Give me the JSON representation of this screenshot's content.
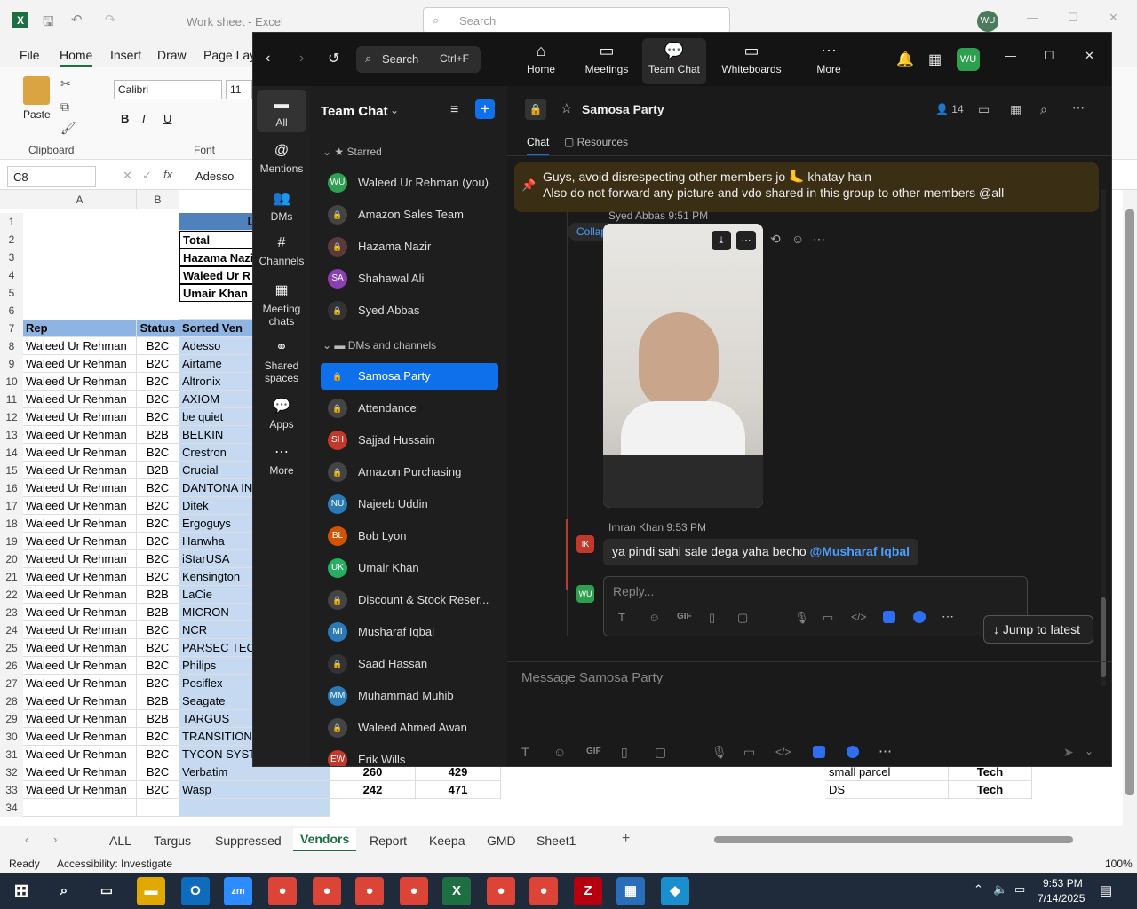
{
  "excel": {
    "title": "Work sheet  -  Excel",
    "search_placeholder": "Search",
    "user_initials": "WU",
    "menu": [
      "File",
      "Home",
      "Insert",
      "Draw",
      "Page Layo"
    ],
    "ribbon": {
      "paste": "Paste",
      "clipboard": "Clipboard",
      "font_name": "Calibri",
      "font_size": "11",
      "font_group": "Font"
    },
    "name_box": "C8",
    "formula": "Adesso",
    "columns": [
      "A",
      "B"
    ],
    "top_rows": [
      {
        "n": "1",
        "c": "Lis"
      },
      {
        "n": "2",
        "c": "Total"
      },
      {
        "n": "3",
        "c": "Hazama Nazi"
      },
      {
        "n": "4",
        "c": "Waleed Ur R"
      },
      {
        "n": "5",
        "c": "Umair Khan"
      },
      {
        "n": "6",
        "c": ""
      }
    ],
    "header_row": {
      "n": "7",
      "a": "Rep",
      "b": "Status",
      "c": "Sorted Ven"
    },
    "rows": [
      {
        "n": "8",
        "a": "Waleed Ur Rehman",
        "b": "B2C",
        "c": "Adesso"
      },
      {
        "n": "9",
        "a": "Waleed Ur Rehman",
        "b": "B2C",
        "c": "Airtame"
      },
      {
        "n": "10",
        "a": "Waleed Ur Rehman",
        "b": "B2C",
        "c": "Altronix"
      },
      {
        "n": "11",
        "a": "Waleed Ur Rehman",
        "b": "B2C",
        "c": "AXIOM"
      },
      {
        "n": "12",
        "a": "Waleed Ur Rehman",
        "b": "B2C",
        "c": "be quiet"
      },
      {
        "n": "13",
        "a": "Waleed Ur Rehman",
        "b": "B2B",
        "c": "BELKIN"
      },
      {
        "n": "14",
        "a": "Waleed Ur Rehman",
        "b": "B2C",
        "c": "Crestron"
      },
      {
        "n": "15",
        "a": "Waleed Ur Rehman",
        "b": "B2B",
        "c": "Crucial"
      },
      {
        "n": "16",
        "a": "Waleed Ur Rehman",
        "b": "B2C",
        "c": "DANTONA IN"
      },
      {
        "n": "17",
        "a": "Waleed Ur Rehman",
        "b": "B2C",
        "c": "Ditek"
      },
      {
        "n": "18",
        "a": "Waleed Ur Rehman",
        "b": "B2C",
        "c": "Ergoguys"
      },
      {
        "n": "19",
        "a": "Waleed Ur Rehman",
        "b": "B2C",
        "c": "Hanwha"
      },
      {
        "n": "20",
        "a": "Waleed Ur Rehman",
        "b": "B2C",
        "c": "iStarUSA"
      },
      {
        "n": "21",
        "a": "Waleed Ur Rehman",
        "b": "B2C",
        "c": "Kensington"
      },
      {
        "n": "22",
        "a": "Waleed Ur Rehman",
        "b": "B2B",
        "c": "LaCie"
      },
      {
        "n": "23",
        "a": "Waleed Ur Rehman",
        "b": "B2B",
        "c": "MICRON"
      },
      {
        "n": "24",
        "a": "Waleed Ur Rehman",
        "b": "B2C",
        "c": "NCR"
      },
      {
        "n": "25",
        "a": "Waleed Ur Rehman",
        "b": "B2C",
        "c": "PARSEC TECH"
      },
      {
        "n": "26",
        "a": "Waleed Ur Rehman",
        "b": "B2C",
        "c": "Philips"
      },
      {
        "n": "27",
        "a": "Waleed Ur Rehman",
        "b": "B2C",
        "c": "Posiflex"
      },
      {
        "n": "28",
        "a": "Waleed Ur Rehman",
        "b": "B2B",
        "c": "Seagate"
      },
      {
        "n": "29",
        "a": "Waleed Ur Rehman",
        "b": "B2B",
        "c": "TARGUS"
      },
      {
        "n": "30",
        "a": "Waleed Ur Rehman",
        "b": "B2C",
        "c": "TRANSITION"
      },
      {
        "n": "31",
        "a": "Waleed Ur Rehman",
        "b": "B2C",
        "c": "TYCON SYSTE"
      },
      {
        "n": "32",
        "a": "Waleed Ur Rehman",
        "b": "B2C",
        "c": "Verbatim",
        "d": "260",
        "e": "429",
        "j": "small parcel",
        "k": "Tech"
      },
      {
        "n": "33",
        "a": "Waleed Ur Rehman",
        "b": "B2C",
        "c": "Wasp",
        "d": "242",
        "e": "471",
        "j": "DS",
        "k": "Tech"
      },
      {
        "n": "34",
        "a": "",
        "b": "",
        "c": ""
      }
    ],
    "sheet_tabs": [
      "ALL",
      "Targus",
      "Suppressed",
      "Vendors",
      "Report",
      "Keepa",
      "GMD",
      "Sheet1"
    ],
    "active_sheet": "Vendors",
    "status_ready": "Ready",
    "accessibility": "Accessibility: Investigate",
    "zoom": "100%"
  },
  "zoom": {
    "search_label": "Search",
    "search_shortcut": "Ctrl+F",
    "nav": [
      "Home",
      "Meetings",
      "Team Chat",
      "Whiteboards",
      "More"
    ],
    "user_initials": "WU",
    "rail": [
      "All",
      "Mentions",
      "DMs",
      "Channels",
      "Meeting chats",
      "Shared spaces",
      "Apps",
      "More"
    ],
    "list_title": "Team Chat",
    "starred_header": "Starred",
    "starred": [
      {
        "name": "Waleed Ur Rehman (you)",
        "initials": "WU",
        "color": "#2e9e4f"
      },
      {
        "name": "Amazon Sales Team",
        "initials": "",
        "color": "#444"
      },
      {
        "name": "Hazama Nazir",
        "initials": "",
        "color": "#5a3a3a"
      },
      {
        "name": "Shahawal Ali",
        "initials": "SA",
        "color": "#8a3fb3"
      },
      {
        "name": "Syed Abbas",
        "initials": "",
        "color": "#333"
      }
    ],
    "dm_header": "DMs and channels",
    "dms": [
      {
        "name": "Samosa Party",
        "initials": "",
        "color": "#0e71eb"
      },
      {
        "name": "Attendance",
        "initials": "",
        "color": "#444"
      },
      {
        "name": "Sajjad Hussain",
        "initials": "SH",
        "color": "#c0392b"
      },
      {
        "name": "Amazon Purchasing",
        "initials": "",
        "color": "#444"
      },
      {
        "name": "Najeeb Uddin",
        "initials": "NU",
        "color": "#2a7ab8"
      },
      {
        "name": "Bob Lyon",
        "initials": "BL",
        "color": "#d35400"
      },
      {
        "name": "Umair Khan",
        "initials": "UK",
        "color": "#27ae60"
      },
      {
        "name": "Discount & Stock Reser...",
        "initials": "",
        "color": "#444"
      },
      {
        "name": "Musharaf Iqbal",
        "initials": "MI",
        "color": "#2a7ab8"
      },
      {
        "name": "Saad Hassan",
        "initials": "",
        "color": "#333"
      },
      {
        "name": "Muhammad Muhib",
        "initials": "MM",
        "color": "#2a7ab8"
      },
      {
        "name": "Waleed Ahmed Awan",
        "initials": "",
        "color": "#444"
      },
      {
        "name": "Erik Wills",
        "initials": "EW",
        "color": "#c0392b"
      }
    ],
    "channel_name": "Samosa Party",
    "member_count": "14",
    "tabs": [
      "Chat",
      "Resources"
    ],
    "pinned_line1": "Guys, avoid disrespecting other members jo 🦶 khatay hain",
    "pinned_line2": "Also do not forward any picture and vdo shared in this group to other members @all",
    "msg1_meta": "Syed Abbas 9:51 PM",
    "collapse_all": "Collapse all",
    "msg2_meta": "Imran Khan 9:53 PM",
    "msg2_initials": "IK",
    "msg2_text": "ya pindi sahi sale dega yaha becho ",
    "msg2_mention": "@Musharaf Iqbal",
    "reply_initials": "WU",
    "reply_placeholder": "Reply...",
    "jump_latest": "Jump to latest",
    "message_placeholder": "Message Samosa Party"
  },
  "taskbar": {
    "time": "9:53 PM",
    "date": "7/14/2025"
  }
}
